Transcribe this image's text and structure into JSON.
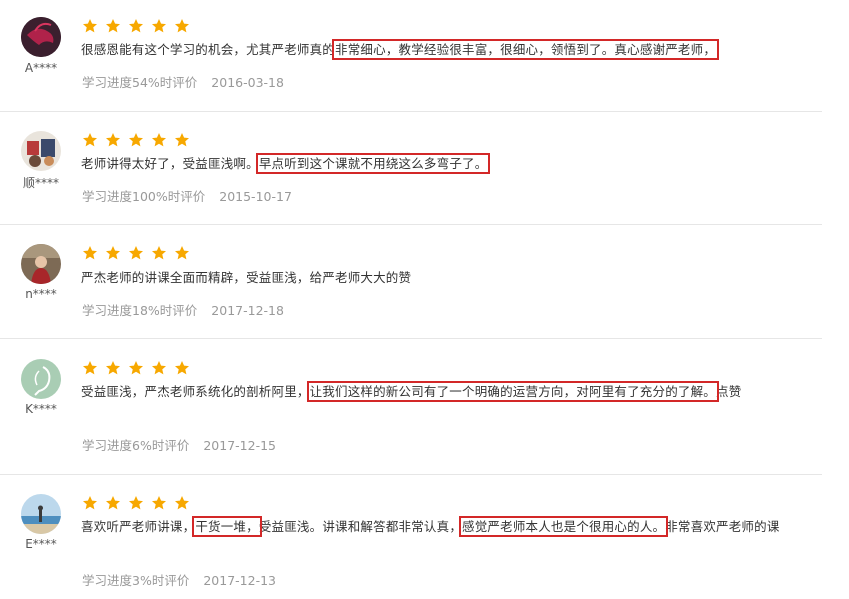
{
  "colors": {
    "star": "#f7a800",
    "highlight_box": "#d32828",
    "meta_text": "#999999"
  },
  "reviews": [
    {
      "user": "A****",
      "rating": 5,
      "text_parts": [
        {
          "t": "很感恩能有这个学习的机会，尤其严老师真的",
          "hl": false
        },
        {
          "t": "非常细心，教学经验很丰富，很细心，领悟到了。真心感谢严老师，",
          "hl": true
        }
      ],
      "progress": "学习进度54%时评价",
      "date": "2016-03-18"
    },
    {
      "user": "顺****",
      "rating": 5,
      "text_parts": [
        {
          "t": "老师讲得太好了，受益匪浅啊。",
          "hl": false
        },
        {
          "t": "早点听到这个课就不用绕这么多弯子了。",
          "hl": true
        }
      ],
      "progress": "学习进度100%时评价",
      "date": "2015-10-17"
    },
    {
      "user": "n****",
      "rating": 5,
      "text_parts": [
        {
          "t": "严杰老师的讲课全面而精辟，受益匪浅，给严老师大大的赞",
          "hl": false
        }
      ],
      "progress": "学习进度18%时评价",
      "date": "2017-12-18"
    },
    {
      "user": "K****",
      "rating": 5,
      "text_parts": [
        {
          "t": "受益匪浅，严杰老师系统化的剖析阿里，",
          "hl": false
        },
        {
          "t": "让我们这样的新公司有了一个明确的运营方向，对阿里有了充分的了解。",
          "hl": true
        },
        {
          "t": "点赞",
          "hl": false
        }
      ],
      "progress": "学习进度6%时评价",
      "date": "2017-12-15"
    },
    {
      "user": "E****",
      "rating": 5,
      "text_parts": [
        {
          "t": "喜欢听严老师讲课，",
          "hl": false
        },
        {
          "t": "干货一堆，",
          "hl": true
        },
        {
          "t": "受益匪浅。讲课和解答都非常认真，",
          "hl": false
        },
        {
          "t": "感觉严老师本人也是个很用心的人。",
          "hl": true
        },
        {
          "t": "非常喜欢严老师的课",
          "hl": false
        }
      ],
      "progress": "学习进度3%时评价",
      "date": "2017-12-13"
    }
  ]
}
